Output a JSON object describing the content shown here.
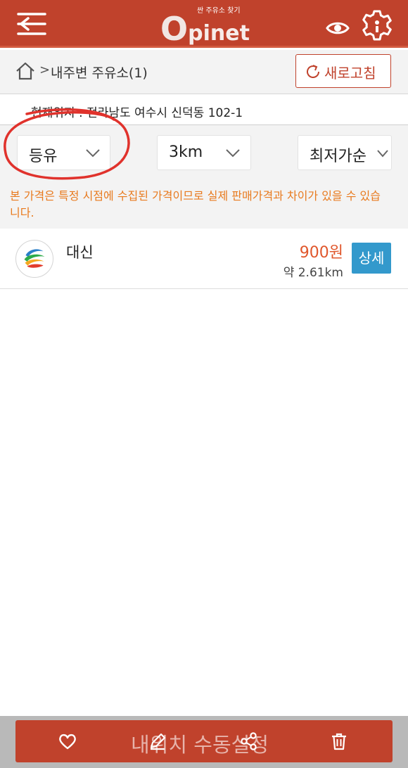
{
  "header": {
    "logo_subtitle": "싼 주유소 찾기",
    "logo_first_letter": "O",
    "logo_rest": "pinet",
    "brand_color": "#c0422c",
    "icons": [
      "menu-back-icon",
      "eye-icon",
      "gear-icon"
    ]
  },
  "breadcrumb": {
    "separator": ">",
    "title": "내주변 주유소(1)",
    "refresh_label": "새로고침"
  },
  "location": {
    "text": "현재위지 : 전라남도 여수시 신덕동 102-1"
  },
  "filters": {
    "fuel": "등유",
    "radius": "3km",
    "sort": "최저가순"
  },
  "notice": "본 가격은 특정 시점에 수집된 가격이므로 실제 판매가격과 차이가 있을 수 있습니다.",
  "stations": [
    {
      "name": "대신",
      "price": "900원",
      "distance": "약 2.61km",
      "detail_label": "상세"
    }
  ],
  "bottom": {
    "manual_label": "내위치 수동설정",
    "icons": [
      "heart-icon",
      "pencil-icon",
      "share-icon",
      "trash-icon"
    ]
  }
}
